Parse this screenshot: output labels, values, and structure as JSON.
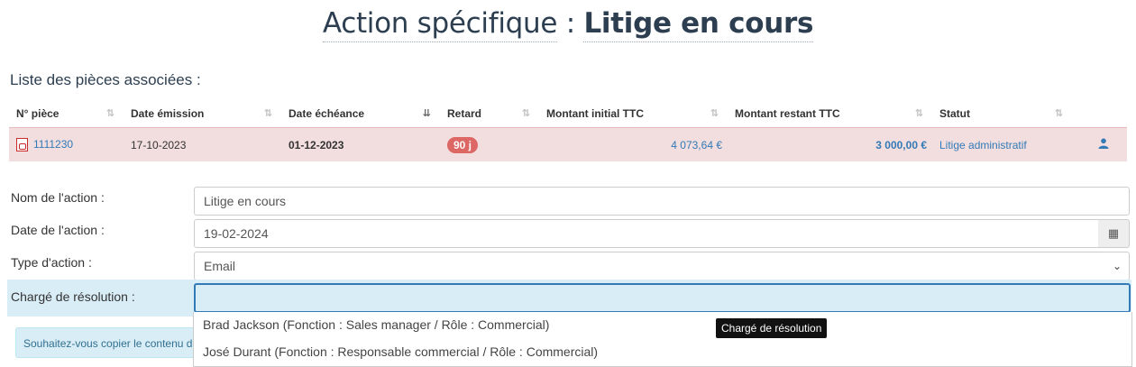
{
  "title": {
    "prefix": "Action spécifique",
    "separator": ":",
    "value": "Litige en cours"
  },
  "pieces": {
    "section_label": "Liste des pièces associées :",
    "columns": [
      "N° pièce",
      "Date émission",
      "Date échéance",
      "Retard",
      "Montant initial TTC",
      "Montant restant TTC",
      "Statut"
    ],
    "rows": [
      {
        "numero": "1111230",
        "date_emission": "17-10-2023",
        "date_echeance": "01-12-2023",
        "retard": "90 j",
        "montant_initial": "4 073,64 €",
        "montant_restant": "3 000,00 €",
        "statut": "Litige administratif"
      }
    ]
  },
  "form": {
    "nom_label": "Nom de l'action :",
    "nom_value": "Litige en cours",
    "date_label": "Date de l'action :",
    "date_value": "19-02-2024",
    "type_label": "Type d'action :",
    "type_value": "Email",
    "resp_label": "Chargé de résolution :",
    "resp_value": ""
  },
  "dropdown": {
    "options": [
      "Brad Jackson (Fonction : Sales manager / Rôle : Commercial)",
      "José Durant (Fonction : Responsable commercial / Rôle : Commercial)"
    ]
  },
  "tooltip": "Chargé de résolution",
  "copy_notice": "Souhaitez-vous copier le contenu d"
}
